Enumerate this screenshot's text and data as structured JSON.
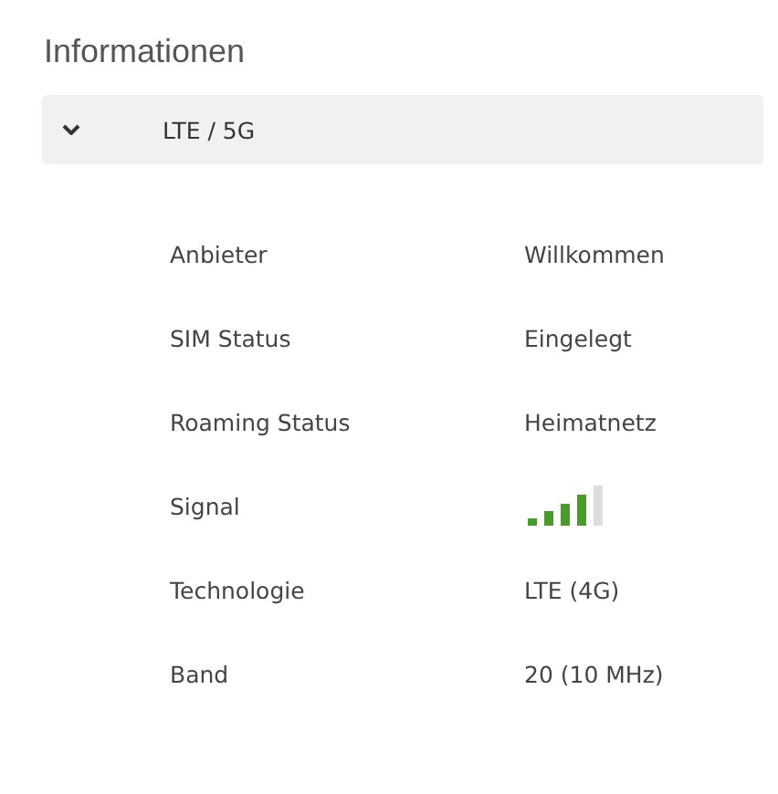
{
  "title": "Informationen",
  "section": {
    "label": "LTE / 5G",
    "expanded": true,
    "rows": [
      {
        "kind": "text",
        "label": "Anbieter",
        "value": "Willkommen"
      },
      {
        "kind": "text",
        "label": "SIM Status",
        "value": "Eingelegt"
      },
      {
        "kind": "text",
        "label": "Roaming Status",
        "value": "Heimatnetz"
      },
      {
        "kind": "signal",
        "label": "Signal"
      },
      {
        "kind": "text",
        "label": "Technologie",
        "value": "LTE (4G)"
      },
      {
        "kind": "text",
        "label": "Band",
        "value": "20 (10 MHz)"
      }
    ]
  }
}
